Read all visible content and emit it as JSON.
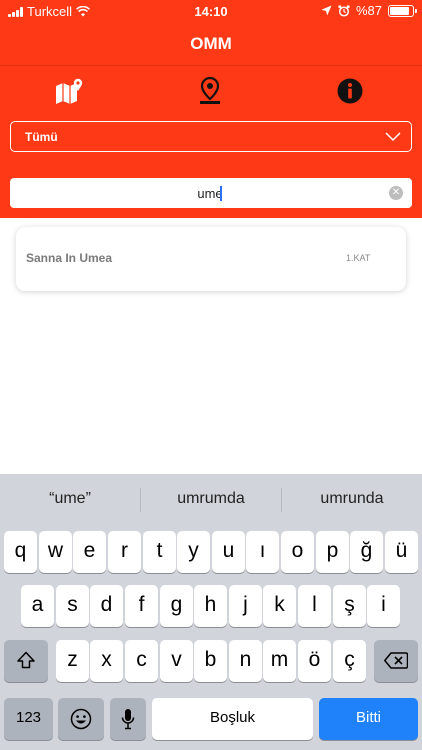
{
  "status_bar": {
    "carrier": "Turkcell",
    "time": "14:10",
    "battery_text": "%87",
    "battery_level": 0.87
  },
  "app_bar": {
    "title": "OMM"
  },
  "icon_tabs": [
    {
      "name": "map-icon"
    },
    {
      "name": "location-pin-icon"
    },
    {
      "name": "info-icon"
    }
  ],
  "filter": {
    "selected": "Tümü"
  },
  "search": {
    "value": "ume",
    "placeholder": ""
  },
  "results": [
    {
      "name": "Sanna In Umea",
      "floor": "1.KAT"
    }
  ],
  "keyboard": {
    "suggestions": [
      "“ume”",
      "umrumda",
      "umrunda"
    ],
    "row1": [
      "q",
      "w",
      "e",
      "r",
      "t",
      "y",
      "u",
      "ı",
      "o",
      "p",
      "ğ",
      "ü"
    ],
    "row2": [
      "a",
      "s",
      "d",
      "f",
      "g",
      "h",
      "j",
      "k",
      "l",
      "ş",
      "i"
    ],
    "row3": [
      "z",
      "x",
      "c",
      "v",
      "b",
      "n",
      "m",
      "ö",
      "ç"
    ],
    "numbers_label": "123",
    "space_label": "Boşluk",
    "done_label": "Bitti"
  },
  "colors": {
    "brand": "#fe3a16",
    "done_key": "#1f82fb",
    "keyboard_bg": "#d1d4da"
  }
}
